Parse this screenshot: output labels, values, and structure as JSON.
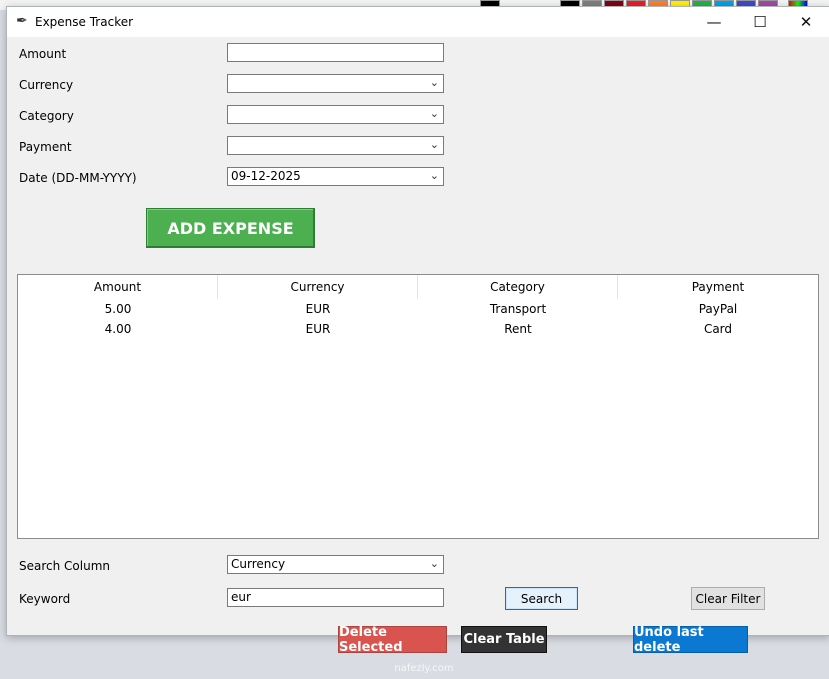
{
  "window": {
    "title": "Expense Tracker",
    "controls": {
      "minimize": "—",
      "maximize": "☐",
      "close": "✕"
    }
  },
  "form": {
    "amount_label": "Amount",
    "amount_value": "",
    "currency_label": "Currency",
    "currency_value": "",
    "category_label": "Category",
    "category_value": "",
    "payment_label": "Payment",
    "payment_value": "",
    "date_label": "Date (DD-MM-YYYY)",
    "date_value": "09-12-2025",
    "add_button": "ADD EXPENSE"
  },
  "table": {
    "columns": [
      "Amount",
      "Currency",
      "Category",
      "Payment"
    ],
    "rows": [
      [
        "5.00",
        "EUR",
        "Transport",
        "PayPal"
      ],
      [
        "4.00",
        "EUR",
        "Rent",
        "Card"
      ]
    ]
  },
  "search": {
    "column_label": "Search Column",
    "column_value": "Currency",
    "keyword_label": "Keyword",
    "keyword_value": "eur",
    "search_button": "Search",
    "clear_filter_button": "Clear Filter"
  },
  "actions": {
    "delete_selected": "Delete Selected",
    "clear_table": "Clear Table",
    "undo_last_delete": "Undo last delete"
  },
  "watermark": "nafezly.com",
  "colors": {
    "add_button": "#4caf50",
    "delete_button": "#d9534f",
    "clear_button": "#333333",
    "undo_button": "#0b78d1"
  }
}
